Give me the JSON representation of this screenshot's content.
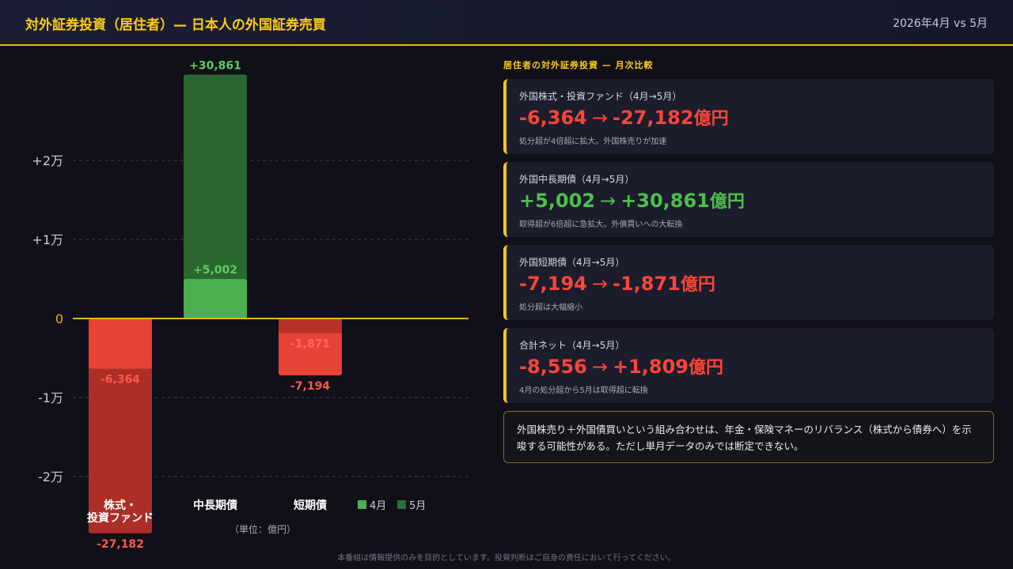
{
  "header": {
    "title": "対外証券投資（居住者）— 日本人の外国証券売買",
    "period": "2026年4月 vs 5月"
  },
  "chart_data": {
    "type": "bar",
    "categories": [
      "株式・\n投資ファンド",
      "中長期債",
      "短期債"
    ],
    "series": [
      {
        "name": "4月",
        "values": [
          -6364,
          5002,
          -7194
        ]
      },
      {
        "name": "5月",
        "values": [
          -27182,
          30861,
          -1871
        ]
      }
    ],
    "value_labels": {
      "4月": [
        "-6,364",
        "+5,002",
        "-7,194"
      ],
      "5月": [
        "-27,182",
        "+30,861",
        "-1,871"
      ]
    },
    "yticks": [
      {
        "value": 20000,
        "label": "+2万"
      },
      {
        "value": 10000,
        "label": "+1万"
      },
      {
        "value": 0,
        "label": "0"
      },
      {
        "value": -10000,
        "label": "-1万"
      },
      {
        "value": -20000,
        "label": "-2万"
      }
    ],
    "unit_note": "（単位：億円）",
    "legend": [
      "4月",
      "5月"
    ],
    "colors": {
      "pos_apr": "#4caf50",
      "pos_may": "#2e6b35",
      "neg_apr": "#e84236",
      "neg_may": "#b53028",
      "zero": "#e6b800",
      "grid": "#3a3d55"
    }
  },
  "panel": {
    "title": "居住者の対外証券投資 — 月次比較",
    "cards": [
      {
        "label": "外国株式・投資ファンド（4月→5月）",
        "from": "-6,364",
        "arrow": "→",
        "to": "-27,182",
        "unit": "億円",
        "from_class": "neg",
        "to_class": "neg",
        "note": "処分超が4倍超に拡大。外国株売りが加速"
      },
      {
        "label": "外国中長期債（4月→5月）",
        "from": "+5,002",
        "arrow": "→",
        "to": "+30,861",
        "unit": "億円",
        "from_class": "pos",
        "to_class": "pos",
        "note": "取得超が6倍超に急拡大。外債買いへの大転換"
      },
      {
        "label": "外国短期債（4月→5月）",
        "from": "-7,194",
        "arrow": "→",
        "to": "-1,871",
        "unit": "億円",
        "from_class": "neg",
        "to_class": "neg",
        "note": "処分超は大幅縮小"
      },
      {
        "label": "合計ネット（4月→5月）",
        "from": "-8,556",
        "arrow": "→",
        "to": "+1,809",
        "unit": "億円",
        "from_class": "neg",
        "to_class": "neg",
        "note": "4月の処分超から5月は取得超に転換"
      }
    ],
    "insight": "外国株売り＋外国債買いという組み合わせは、年金・保険マネーのリバランス（株式から債券へ）を示唆する可能性がある。ただし単月データのみでは断定できない。"
  },
  "disclaimer": "本番組は情報提供のみを目的としています。投資判断はご自身の責任において行ってください。"
}
